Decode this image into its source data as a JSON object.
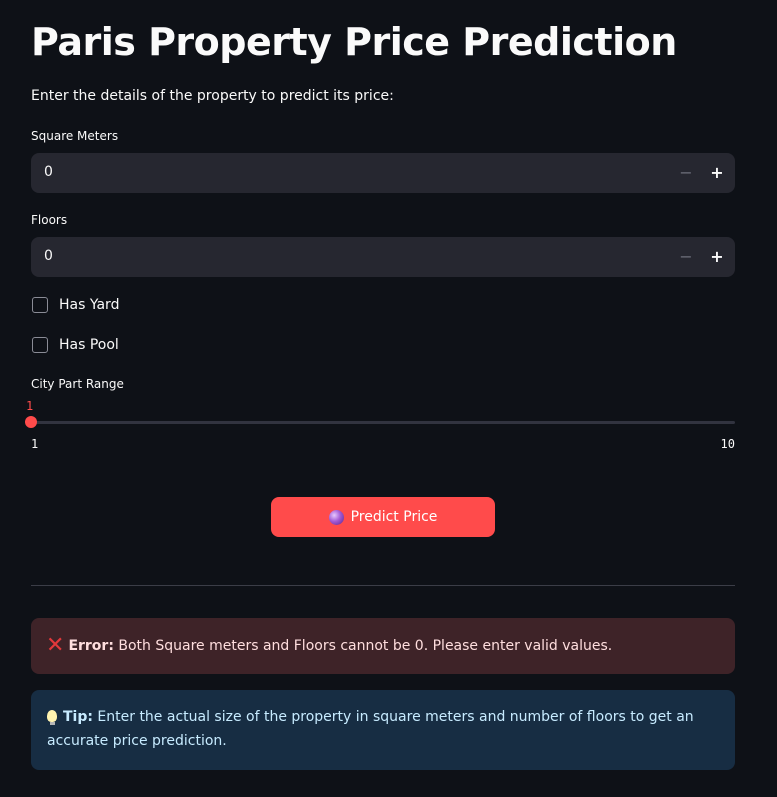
{
  "page": {
    "title": "Paris Property Price Prediction",
    "intro": "Enter the details of the property to predict its price:"
  },
  "fields": {
    "square_meters": {
      "label": "Square Meters",
      "value": "0",
      "minus": "−",
      "plus": "+"
    },
    "floors": {
      "label": "Floors",
      "value": "0",
      "minus": "−",
      "plus": "+"
    }
  },
  "checkboxes": {
    "has_yard": {
      "label": "Has Yard",
      "checked": false
    },
    "has_pool": {
      "label": "Has Pool",
      "checked": false
    }
  },
  "slider": {
    "label": "City Part Range",
    "value": "1",
    "min": "1",
    "max": "10"
  },
  "predict_button": {
    "label": "Predict Price",
    "icon": "crystal-ball-icon"
  },
  "alerts": {
    "error": {
      "icon": "cross-mark-icon",
      "icon_glyph": "✕",
      "prefix": "Error:",
      "message": " Both Square meters and Floors cannot be 0. Please enter valid values."
    },
    "tip": {
      "icon": "light-bulb-icon",
      "prefix": "Tip:",
      "message": " Enter the actual size of the property in square meters and number of floors to get an accurate price prediction."
    }
  },
  "colors": {
    "background": "#0e1117",
    "accent": "#ff4b4b",
    "input_background": "#262730",
    "error_background": "#3e2328",
    "info_background": "#172d43"
  }
}
